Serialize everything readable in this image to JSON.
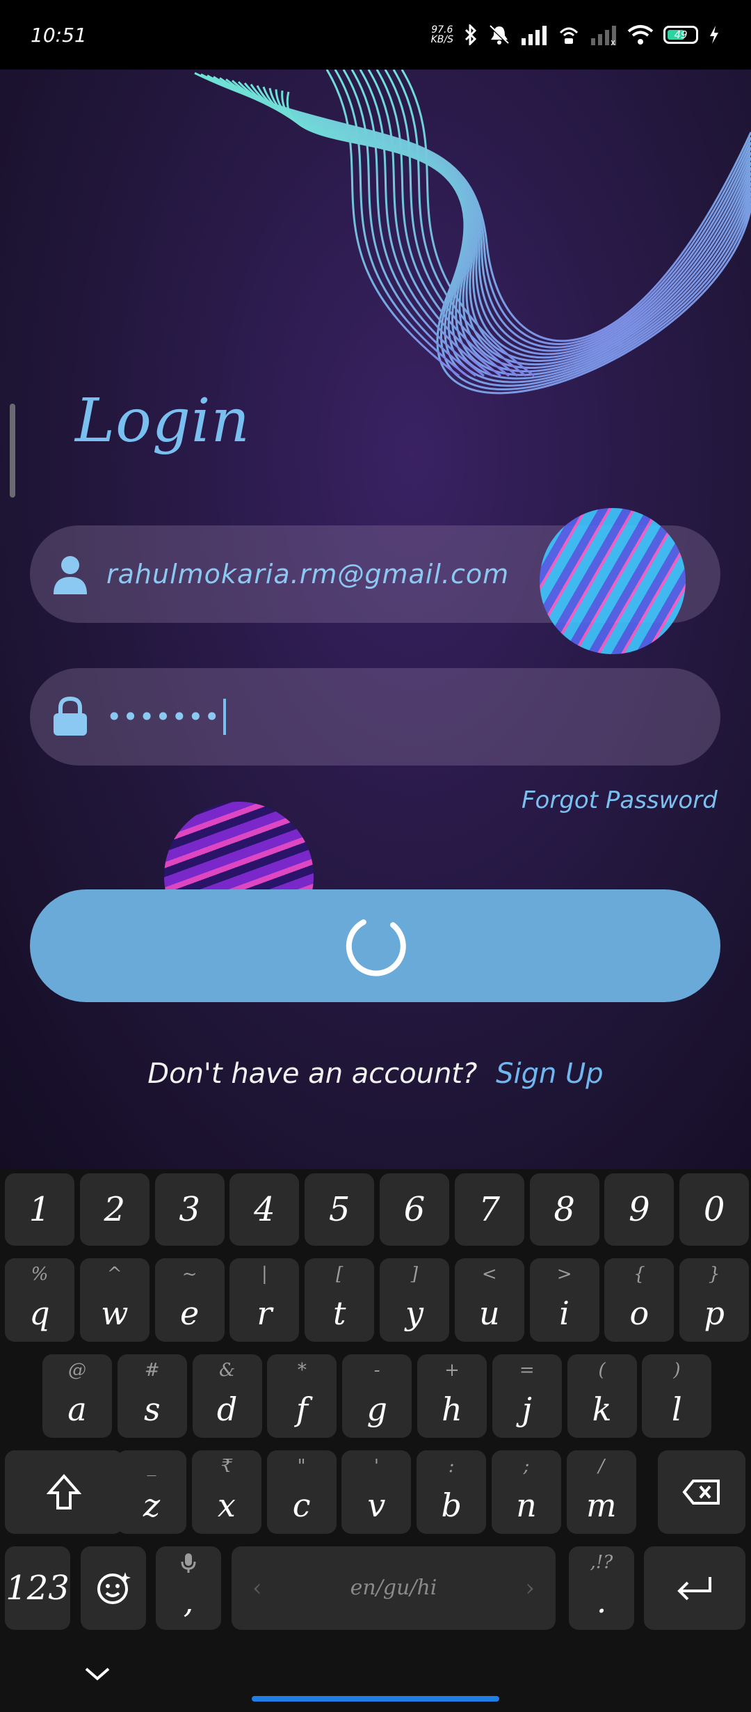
{
  "status_bar": {
    "time": "10:51",
    "net_speed_value": "97.6",
    "net_speed_unit": "KB/S",
    "battery_level": "49"
  },
  "login": {
    "title": "Login",
    "email_value": "rahulmokaria.rm@gmail.com",
    "password_mask": "•••••••",
    "forgot_password": "Forgot Password",
    "signup_prompt": "Don't have an account?",
    "signup_link": "Sign Up",
    "colors": {
      "accent": "#79bff0",
      "button": "#6aaad8",
      "field_bg": "#5a4a73"
    }
  },
  "icons": {
    "email": "user-icon",
    "password": "lock-icon",
    "loading": "spinner-icon"
  },
  "keyboard": {
    "number_row": [
      "1",
      "2",
      "3",
      "4",
      "5",
      "6",
      "7",
      "8",
      "9",
      "0"
    ],
    "row1": [
      {
        "k": "q",
        "s": "%"
      },
      {
        "k": "w",
        "s": "^"
      },
      {
        "k": "e",
        "s": "~"
      },
      {
        "k": "r",
        "s": "|"
      },
      {
        "k": "t",
        "s": "["
      },
      {
        "k": "y",
        "s": "]"
      },
      {
        "k": "u",
        "s": "<"
      },
      {
        "k": "i",
        "s": ">"
      },
      {
        "k": "o",
        "s": "{"
      },
      {
        "k": "p",
        "s": "}"
      }
    ],
    "row2": [
      {
        "k": "a",
        "s": "@"
      },
      {
        "k": "s",
        "s": "#"
      },
      {
        "k": "d",
        "s": "&"
      },
      {
        "k": "f",
        "s": "*"
      },
      {
        "k": "g",
        "s": "-"
      },
      {
        "k": "h",
        "s": "+"
      },
      {
        "k": "j",
        "s": "="
      },
      {
        "k": "k",
        "s": "("
      },
      {
        "k": "l",
        "s": ")"
      }
    ],
    "row3": [
      {
        "k": "z",
        "s": "_"
      },
      {
        "k": "x",
        "s": "₹"
      },
      {
        "k": "c",
        "s": "\""
      },
      {
        "k": "v",
        "s": "'"
      },
      {
        "k": "b",
        "s": ":"
      },
      {
        "k": "n",
        "s": ";"
      },
      {
        "k": "m",
        "s": "/"
      }
    ],
    "symbols_key": "123",
    "comma_key": ",",
    "period_key": ".",
    "period_sub": ",!?",
    "space_label": "en/gu/hi"
  }
}
